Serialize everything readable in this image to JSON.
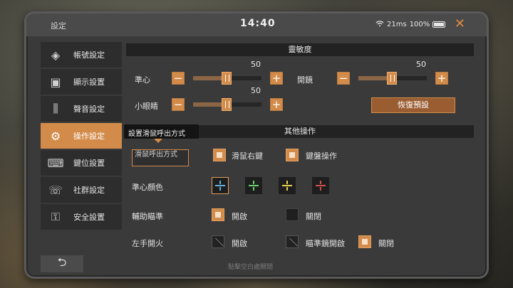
{
  "window": {
    "title": "設定",
    "time": "14:40",
    "latency": "21ms",
    "battery": "100%"
  },
  "icons": {
    "wifi": "wifi-icon",
    "close": "close-icon",
    "back": "back-arrow-icon"
  },
  "sidebar": {
    "items": [
      {
        "label": "帳號設定",
        "icon": "account-icon"
      },
      {
        "label": "顯示設置",
        "icon": "display-icon"
      },
      {
        "label": "聲音設定",
        "icon": "sound-sliders-icon"
      },
      {
        "label": "操作設定",
        "icon": "controls-gear-icon",
        "active": true
      },
      {
        "label": "鍵位設置",
        "icon": "keyboard-icon"
      },
      {
        "label": "社群設定",
        "icon": "social-icon"
      },
      {
        "label": "安全設置",
        "icon": "lock-icon"
      }
    ]
  },
  "tooltip": "設置滑鼠呼出方式",
  "sensitivity": {
    "header": "靈敏度",
    "crosshair": {
      "label": "準心",
      "value": "50"
    },
    "scope": {
      "label": "開鏡",
      "value": "50"
    },
    "small_eye": {
      "label": "小眼睛",
      "value": "50"
    },
    "reset": "恢復預設",
    "minus": "−",
    "plus": "+"
  },
  "other": {
    "header": "其他操作",
    "mouse_callout": {
      "label": "滑鼠呼出方式",
      "opt1": "滑鼠右鍵",
      "opt2": "鍵盤操作"
    },
    "crosshair_color": {
      "label": "準心顏色",
      "colors": [
        "#5fb0e0",
        "#6ad06a",
        "#e6d050",
        "#d05050"
      ]
    },
    "aim_assist": {
      "label": "輔助瞄準",
      "on": "開啟",
      "off": "關閉"
    },
    "left_fire": {
      "label": "左手開火",
      "on": "開啟",
      "scope_on": "瞄準鏡開啟",
      "off": "關閉"
    }
  },
  "footer": {
    "hint": "點擊空白處關閉"
  },
  "colors": {
    "accent": "#d38b4a",
    "panel": "#3a3a3a"
  }
}
